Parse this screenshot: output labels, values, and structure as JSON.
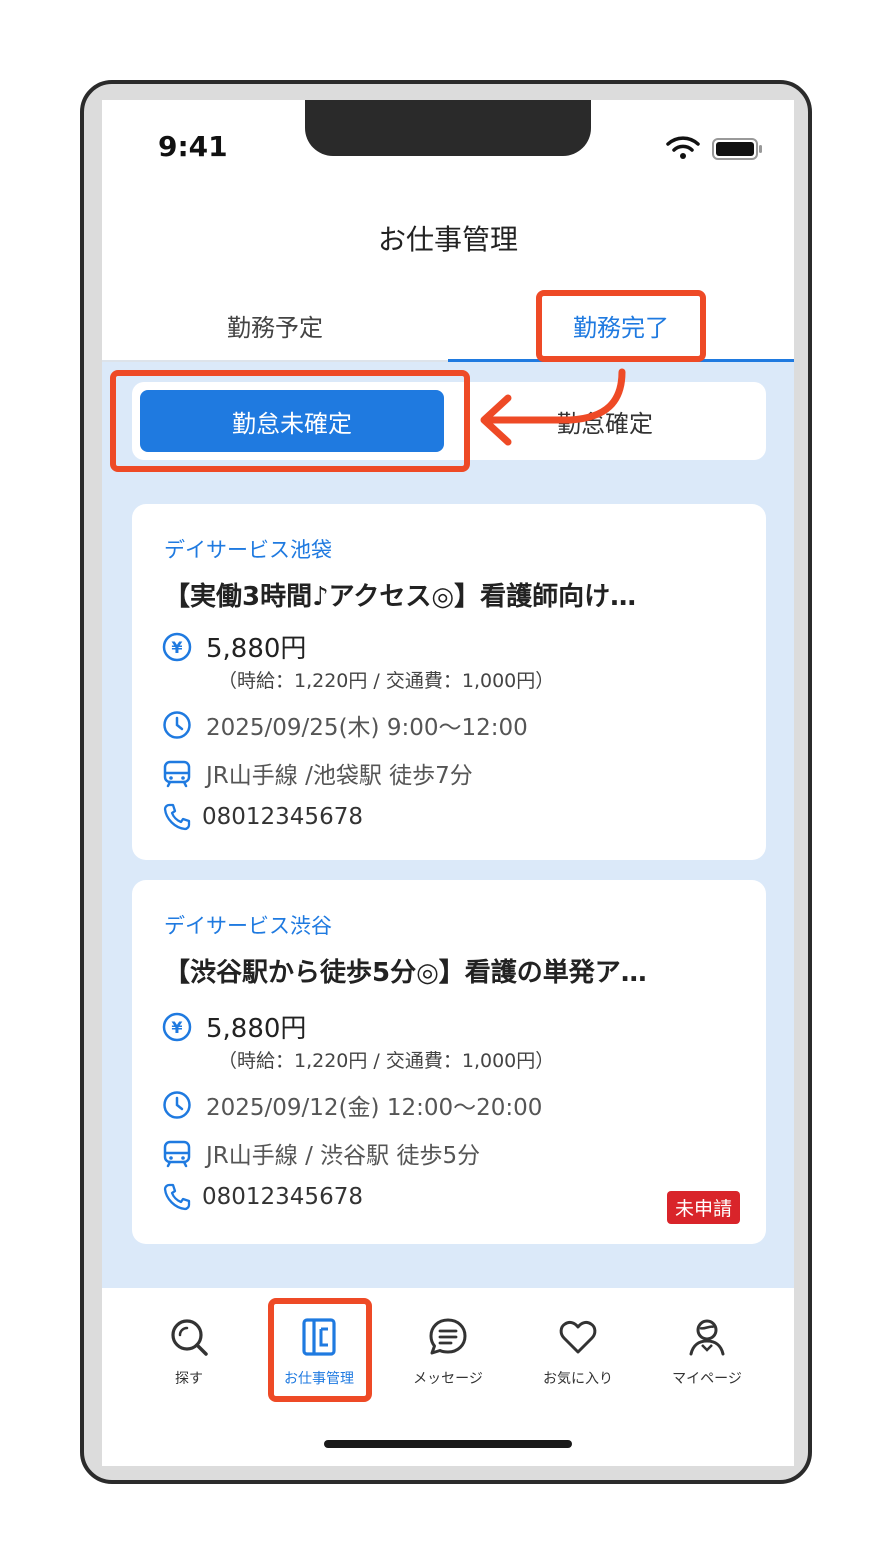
{
  "status_bar": {
    "time": "9:41"
  },
  "header": {
    "title": "お仕事管理"
  },
  "tabs": [
    {
      "label": "勤務予定",
      "active": false
    },
    {
      "label": "勤務完了",
      "active": true
    }
  ],
  "segment": [
    {
      "label": "勤怠未確定",
      "active": true
    },
    {
      "label": "勤怠確定",
      "active": false
    }
  ],
  "jobs": [
    {
      "facility": "デイサービス池袋",
      "title": "【実働3時間♪アクセス◎】看護師向け…",
      "wage": "5,880円",
      "wage_detail": "（時給：1,220円 / 交通費：1,000円）",
      "datetime": "2025/09/25(木) 9:00〜12:00",
      "access": "JR山手線 /池袋駅 徒歩7分",
      "phone": "08012345678",
      "badge": ""
    },
    {
      "facility": "デイサービス渋谷",
      "title": "【渋谷駅から徒歩5分◎】看護の単発ア…",
      "wage": "5,880円",
      "wage_detail": "（時給：1,220円 / 交通費：1,000円）",
      "datetime": "2025/09/12(金) 12:00〜20:00",
      "access": "JR山手線 / 渋谷駅 徒歩5分",
      "phone": "08012345678",
      "badge": "未申請"
    }
  ],
  "nav": [
    {
      "label": "探す",
      "icon": "search-icon",
      "active": false
    },
    {
      "label": "お仕事管理",
      "icon": "job-management-icon",
      "active": true
    },
    {
      "label": "メッセージ",
      "icon": "message-icon",
      "active": false
    },
    {
      "label": "お気に入り",
      "icon": "heart-icon",
      "active": false
    },
    {
      "label": "マイページ",
      "icon": "profile-icon",
      "active": false
    }
  ],
  "colors": {
    "accent": "#1f7ae0",
    "highlight": "#ee4a26",
    "badge": "#d9242a",
    "content_bg": "#dbe9f9"
  }
}
